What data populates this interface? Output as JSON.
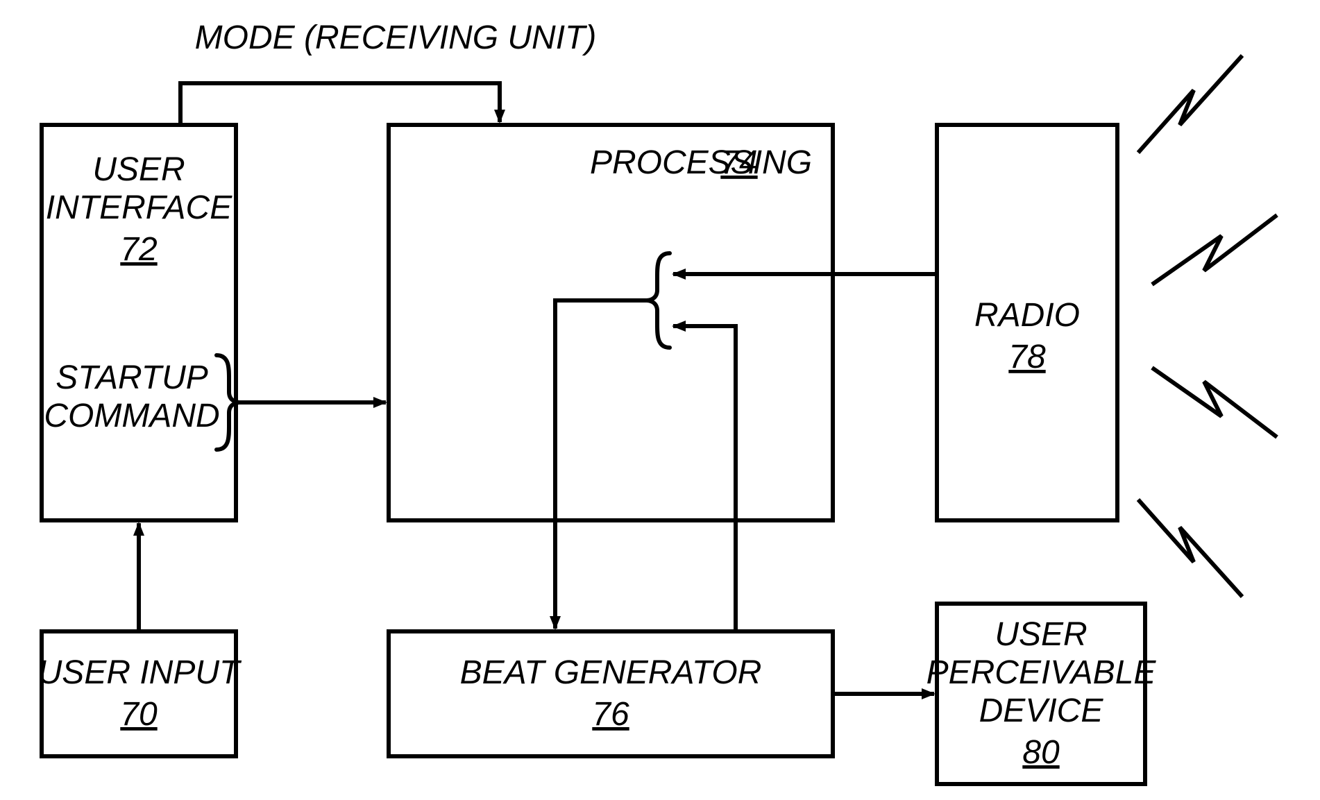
{
  "labels": {
    "mode": "MODE (RECEIVING  UNIT)",
    "userInterface": "USER INTERFACE",
    "userInterfaceLine1": "USER",
    "userInterfaceLine2": "INTERFACE",
    "userInterfaceRef": "72",
    "startupCommand1": "STARTUP",
    "startupCommand2": "COMMAND",
    "processing": "PROCESSING",
    "processingRef": "74",
    "radio": "RADIO",
    "radioRef": "78",
    "userInput": "USER INPUT",
    "userInputRef": "70",
    "beatGenerator": "BEAT GENERATOR",
    "beatGeneratorRef": "76",
    "userPerceivable1": "USER",
    "userPerceivable2": "PERCEIVABLE",
    "userPerceivable3": "DEVICE",
    "userPerceivableRef": "80"
  }
}
